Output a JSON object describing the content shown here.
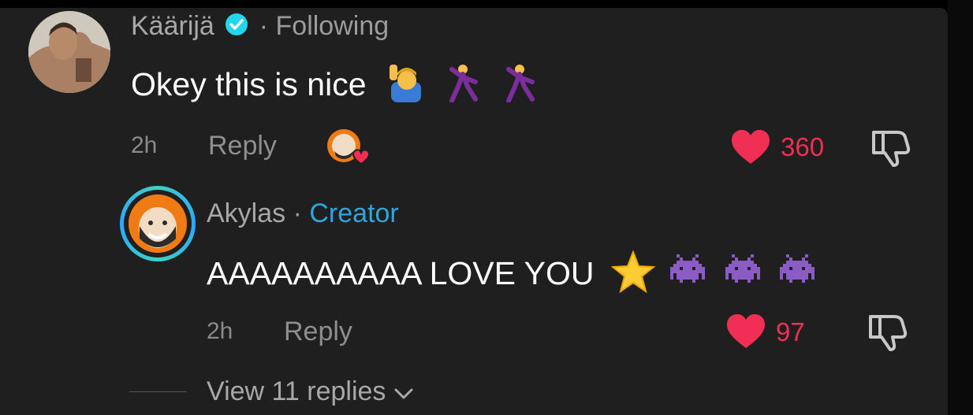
{
  "comment": {
    "username": "Käärijä",
    "following_label": "· Following",
    "text": "Okey this is nice",
    "time": "2h",
    "reply_label": "Reply",
    "likes": "360",
    "verified_icon": "verified-check-icon",
    "emoji_icons": [
      "person-raising-hand-emoji",
      "man-dancing-emoji",
      "man-dancing-emoji"
    ]
  },
  "reply": {
    "username": "Akylas",
    "separator": "·",
    "badge": "Creator",
    "text": "AAAAAAAAAA LOVE YOU",
    "time": "2h",
    "reply_label": "Reply",
    "likes": "97",
    "emoji_icons": [
      "star-emoji",
      "alien-monster-emoji",
      "alien-monster-emoji",
      "alien-monster-emoji"
    ]
  },
  "view_replies": {
    "label": "View 11 replies"
  },
  "colors": {
    "background": "#1f1f1f",
    "like_red": "#f12f55",
    "creator_blue": "#2ba6e0"
  }
}
